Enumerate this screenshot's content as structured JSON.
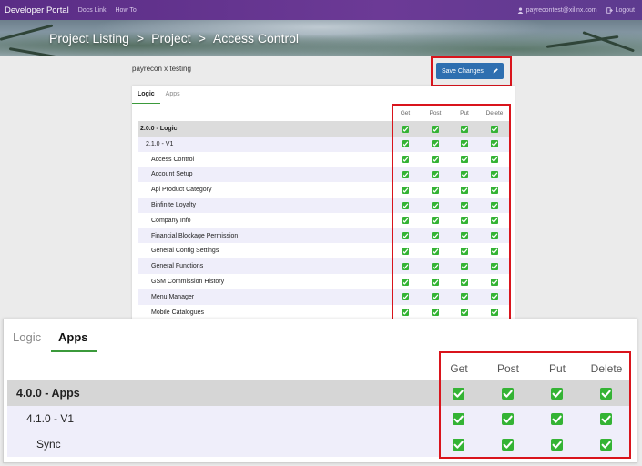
{
  "nav": {
    "brand": "Developer Portal",
    "links": [
      "Docs Link",
      "How To"
    ],
    "user_email": "payrecontest@xilinx.com",
    "logout": "Logout"
  },
  "banner": {
    "crumbs": [
      "Project Listing",
      ">",
      "Project",
      ">",
      "Access Control"
    ]
  },
  "project_name": "payrecon x testing",
  "save_button": "Save Changes",
  "small_panel": {
    "tabs": [
      "Logic",
      "Apps"
    ],
    "active_tab": "Logic",
    "columns": [
      "Get",
      "Post",
      "Put",
      "Delete"
    ],
    "rows": [
      {
        "label": "2.0.0 - Logic",
        "level": 0
      },
      {
        "label": "2.1.0 - V1",
        "level": 1
      },
      {
        "label": "Access Control",
        "level": 2
      },
      {
        "label": "Account Setup",
        "level": 2
      },
      {
        "label": "Api Product Category",
        "level": 2
      },
      {
        "label": "Binfinite Loyalty",
        "level": 2
      },
      {
        "label": "Company Info",
        "level": 2
      },
      {
        "label": "Financial Blockage Permission",
        "level": 2
      },
      {
        "label": "General Config Settings",
        "level": 2
      },
      {
        "label": "General Functions",
        "level": 2
      },
      {
        "label": "GSM Commission History",
        "level": 2
      },
      {
        "label": "Menu Manager",
        "level": 2
      },
      {
        "label": "Mobile Catalogues",
        "level": 2
      }
    ]
  },
  "zoom_panel": {
    "tabs": [
      "Logic",
      "Apps"
    ],
    "active_tab": "Apps",
    "columns": [
      "Get",
      "Post",
      "Put",
      "Delete"
    ],
    "rows": [
      {
        "label": "4.0.0 - Apps",
        "level": 0
      },
      {
        "label": "4.1.0 - V1",
        "level": 1
      },
      {
        "label": "Sync",
        "level": 2
      }
    ]
  },
  "colors": {
    "nav": "#5a2d86",
    "accent_green": "#34b334",
    "highlight": "#d9141c",
    "button": "#2e6fb0"
  }
}
